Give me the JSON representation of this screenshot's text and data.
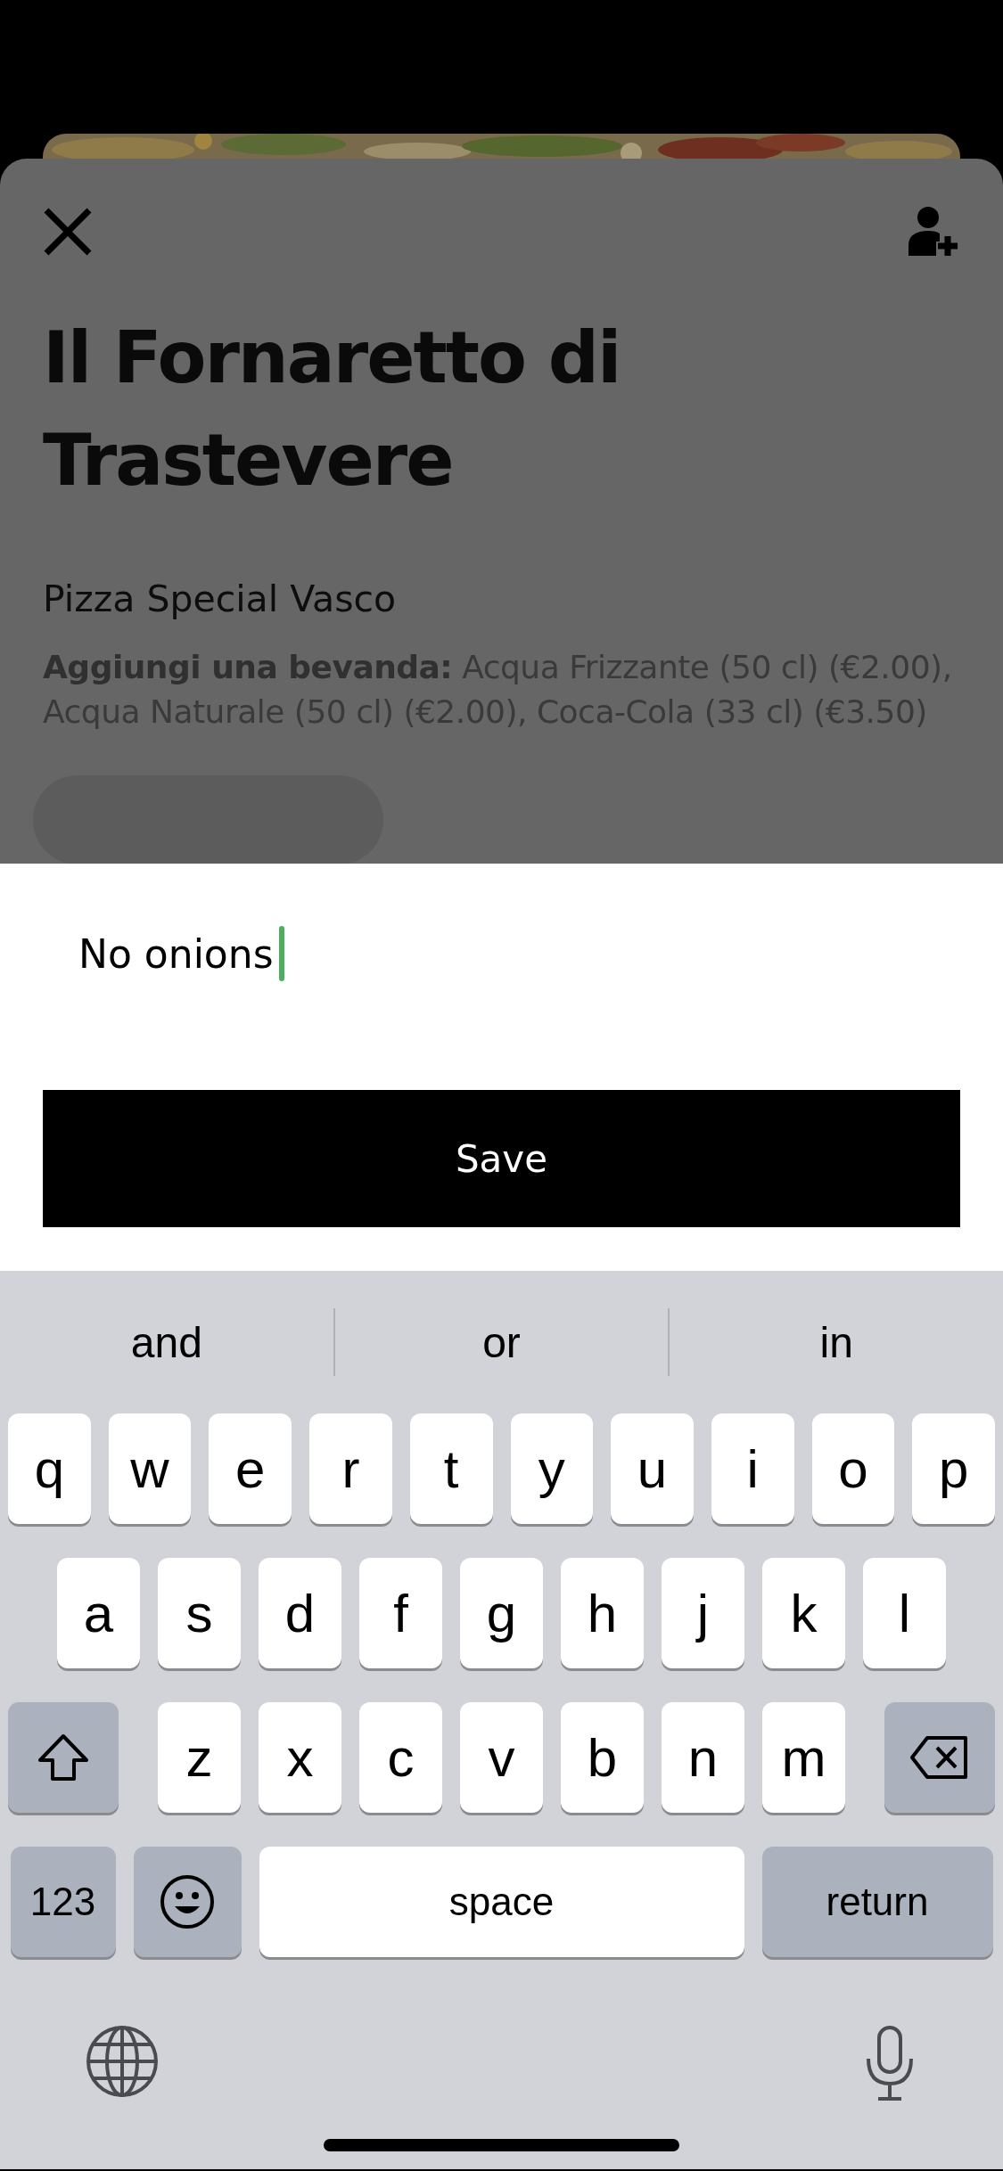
{
  "sheet": {
    "title": "Il Fornaretto di Trastevere",
    "item_name": "Pizza Special Vasco",
    "description": "**Aggiungi una bevanda:** Acqua Frizzante (50 cl) (€2.00), Acqua Naturale (50 cl) (€2.00), Coca-Cola (33 cl) (€3.50)"
  },
  "note_field": {
    "value": "No onions"
  },
  "save_button": {
    "label": "Save"
  },
  "keyboard": {
    "suggestions": [
      "and",
      "or",
      "in"
    ],
    "letter_rows": [
      [
        "q",
        "w",
        "e",
        "r",
        "t",
        "y",
        "u",
        "i",
        "o",
        "p"
      ],
      [
        "a",
        "s",
        "d",
        "f",
        "g",
        "h",
        "j",
        "k",
        "l"
      ],
      [
        "z",
        "x",
        "c",
        "v",
        "b",
        "n",
        "m"
      ]
    ],
    "mode_key": "123",
    "space_key": "space",
    "return_key": "return"
  }
}
